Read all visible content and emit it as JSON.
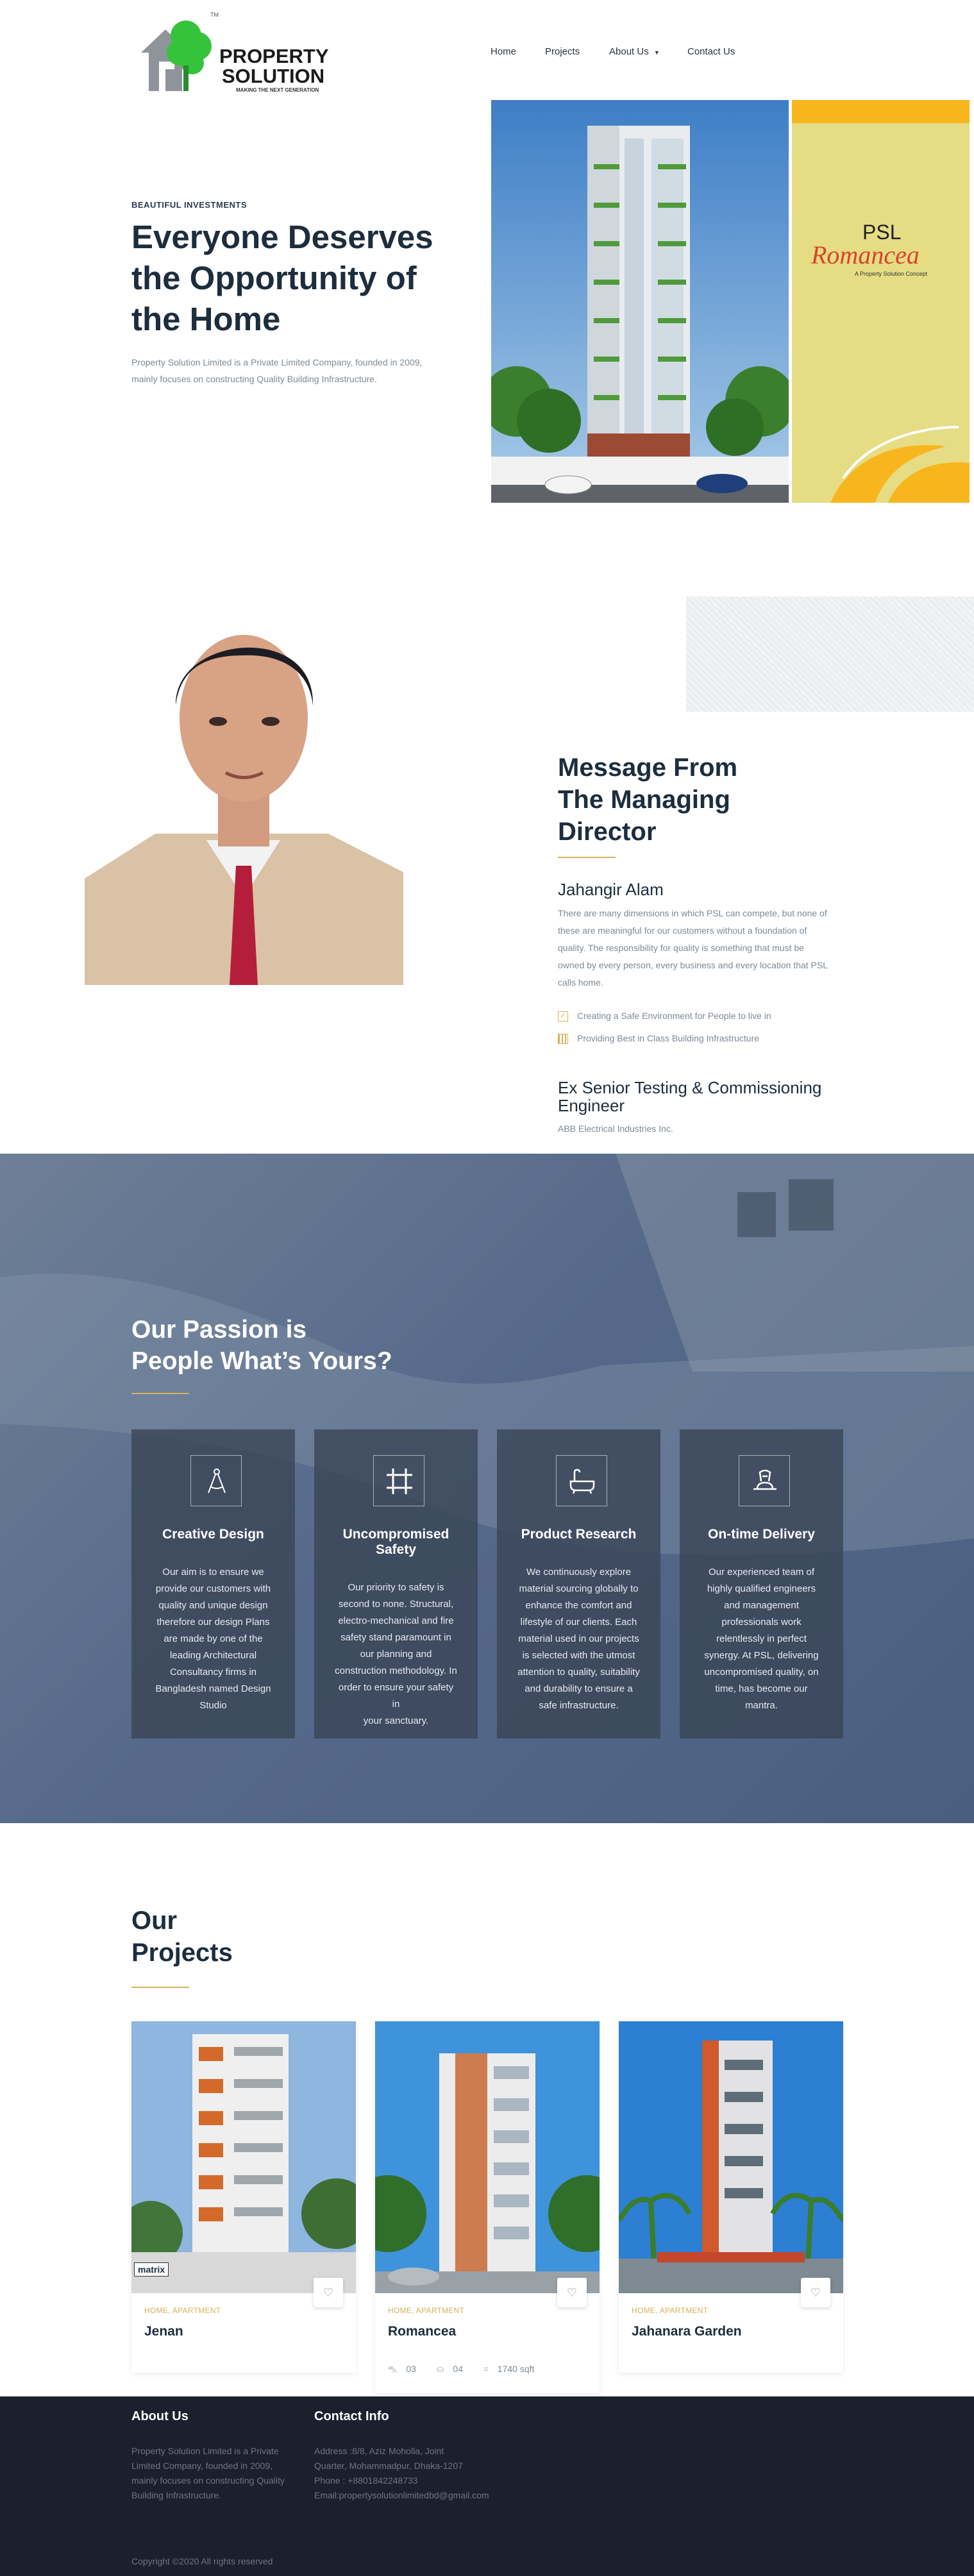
{
  "header": {
    "logo": {
      "line1": "PROPERTY",
      "line2": "SOLUTION",
      "tagline": "MAKING THE NEXT GENERATION",
      "tm": "TM"
    },
    "nav": [
      "Home",
      "Projects",
      "About Us",
      "Contact Us"
    ]
  },
  "hero": {
    "eyebrow": "BEAUTIFUL INVESTMENTS",
    "title_lines": [
      "Everyone Deserves",
      "the Opportunity of",
      "the Home"
    ],
    "description_lines": [
      "Property Solution Limited is a Private Limited Company, founded in 2009,",
      "mainly focuses on constructing Quality Building Infrastructure."
    ],
    "banner": {
      "brand": "PSL",
      "script": "Romancea",
      "sub": "A Property Solution Concept"
    }
  },
  "director": {
    "heading_lines": [
      "Message From",
      "The Managing",
      "Director"
    ],
    "name": "Jahangir Alam",
    "message_lines": [
      "There are many dimensions in which PSL can compete, but none of",
      "these are meaningful for our customers without a foundation of",
      "quality. The responsibility for quality is something that must be",
      "owned by every person, every business and every location that PSL",
      "calls home."
    ],
    "points": [
      "Creating a Safe Environment for People to live in",
      "Providing Best in Class Building Infrastructure"
    ],
    "role_lines": [
      "Ex Senior Testing & Commissioning",
      "Engineer"
    ],
    "company": "ABB Electrical Industries Inc."
  },
  "passion": {
    "heading_lines": [
      "Our Passion is",
      "People What’s Yours?"
    ],
    "cards": [
      {
        "icon": "compass-icon",
        "title_lines": [
          "Creative Design"
        ],
        "text_lines": [
          "Our aim is to ensure we",
          "provide our customers with",
          "quality and unique design",
          "therefore our design Plans",
          "are made by one of the",
          "leading Architectural",
          "Consultancy firms in",
          "Bangladesh named Design",
          "Studio"
        ]
      },
      {
        "icon": "frame-icon",
        "title_lines": [
          "Uncompromised",
          "Safety"
        ],
        "text_lines": [
          "Our priority to safety is",
          "second to none. Structural,",
          "electro-mechanical and fire",
          "safety stand paramount in",
          "our planning and",
          "construction methodology. In",
          "order to ensure your safety in",
          "your sanctuary."
        ]
      },
      {
        "icon": "bathtub-icon",
        "title_lines": [
          "Product Research"
        ],
        "text_lines": [
          "We continuously explore",
          "material sourcing globally to",
          "enhance the comfort and",
          "lifestyle of our clients. Each",
          "material used in our projects",
          "is selected with the utmost",
          "attention to quality, suitability",
          "and durability to ensure a",
          "safe infrastructure."
        ]
      },
      {
        "icon": "delivery-icon",
        "title_lines": [
          "On-time Delivery"
        ],
        "text_lines": [
          "Our experienced team of",
          "highly qualified engineers",
          "and management",
          "professionals work",
          "relentlessly in perfect",
          "synergy. At PSL, delivering",
          "uncompromised quality, on",
          "time, has become our",
          "mantra."
        ]
      }
    ]
  },
  "projects": {
    "heading_lines": [
      "Our",
      "Projects"
    ],
    "items": [
      {
        "tag": "HOME, APARTMENT",
        "name": "Jenan",
        "watermark": "matrix"
      },
      {
        "tag": "HOME, APARTMENT",
        "name": "Romancea",
        "beds": "03",
        "baths": "04",
        "area": "1740 sqft"
      },
      {
        "tag": "HOME, APARTMENT",
        "name": "Jahanara Garden"
      }
    ]
  },
  "footer": {
    "about_title": "About Us",
    "about_lines": [
      "Property Solution Limited is a Private",
      "Limited Company, founded in 2009,",
      "mainly focuses on constructing Quality",
      "Building Infrastructure."
    ],
    "contact_title": "Contact Info",
    "contact_lines": [
      "Address :8/8, Aziz Moholla, Joint",
      "Quarter, Mohammadpur, Dhaka-1207",
      "Phone : +8801842248733",
      "Email:propertysolutionlimitedbd@gmail.com"
    ],
    "copyright": "Copyright ©2020 All rights reserved"
  },
  "colors": {
    "gold": "#d7b25b",
    "navy": "#1d2d3d",
    "footer": "#1c1f2e",
    "passion_bg": "#5b6f8c",
    "logo_green": "#35c33b"
  }
}
